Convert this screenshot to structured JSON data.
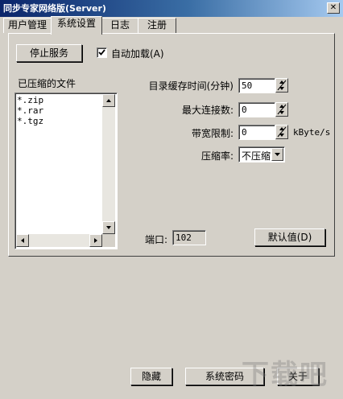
{
  "window": {
    "title": "同步专家网络版(Server)"
  },
  "tabs": [
    {
      "label": "用户管理",
      "active": false
    },
    {
      "label": "系统设置",
      "active": true
    },
    {
      "label": "日志",
      "active": false
    },
    {
      "label": "注册",
      "active": false
    }
  ],
  "service": {
    "stop_label": "停止服务",
    "autoload_label": "自动加载(A)",
    "autoload_checked": true
  },
  "files": {
    "label": "已压缩的文件",
    "items": [
      "*.zip",
      "*.rar",
      "*.tgz"
    ]
  },
  "settings": {
    "cache_time_label": "目录缓存时间(分钟)",
    "cache_time_value": "50",
    "max_conn_label": "最大连接数:",
    "max_conn_value": "0",
    "bandwidth_label": "带宽限制:",
    "bandwidth_value": "0",
    "bandwidth_unit": "kByte/s",
    "compression_label": "压缩率:",
    "compression_value": "不压缩",
    "port_label": "端口:",
    "port_value": "102",
    "default_label": "默认值(D)"
  },
  "footer": {
    "hide_label": "隐藏",
    "syspass_label": "系统密码",
    "close_label": "关于"
  },
  "watermark": {
    "text": "下载吧"
  }
}
